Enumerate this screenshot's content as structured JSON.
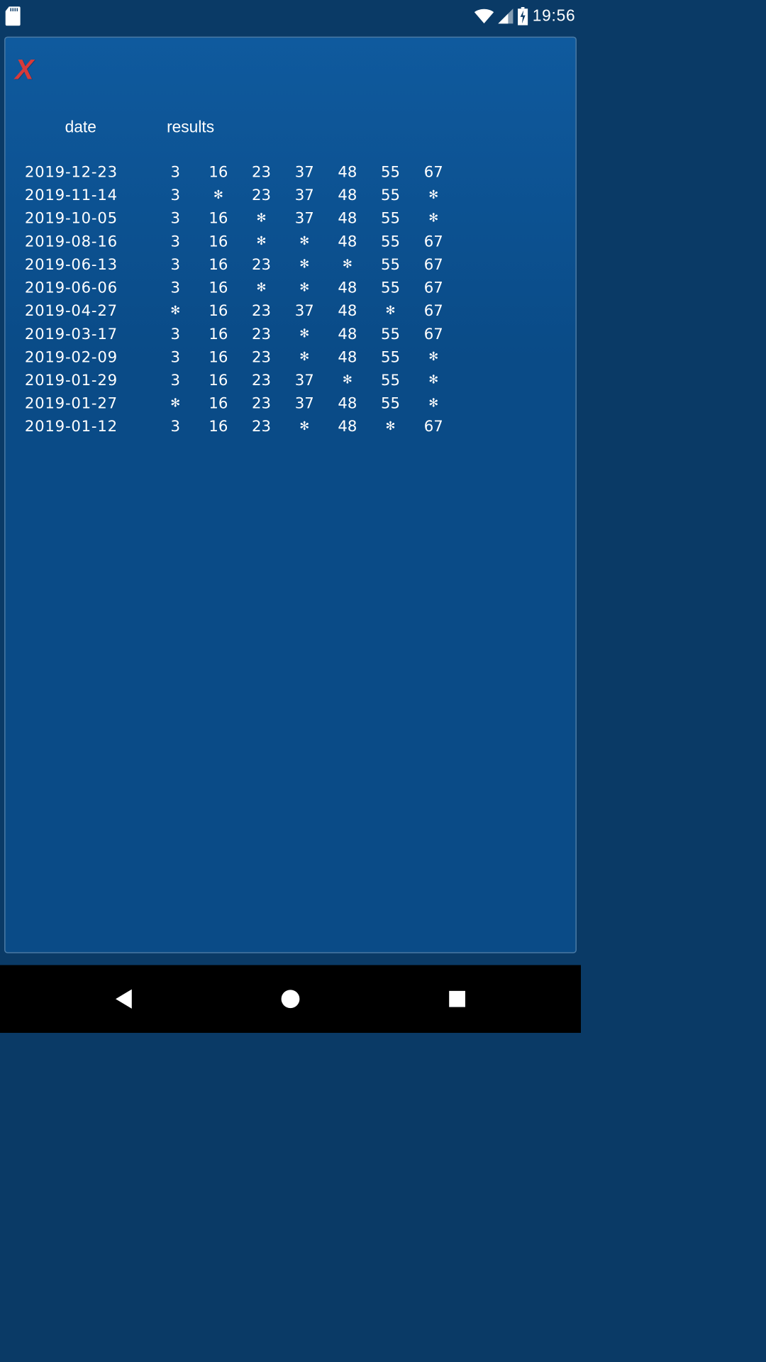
{
  "status": {
    "time": "19:56"
  },
  "panel": {
    "close_label": "X",
    "headers": {
      "date": "date",
      "results": "results"
    },
    "rows": [
      {
        "date": "2019-12-23",
        "cells": [
          "3",
          "16",
          "23",
          "37",
          "48",
          "55",
          "67"
        ]
      },
      {
        "date": "2019-11-14",
        "cells": [
          "3",
          "*",
          "23",
          "37",
          "48",
          "55",
          "*"
        ]
      },
      {
        "date": "2019-10-05",
        "cells": [
          "3",
          "16",
          "*",
          "37",
          "48",
          "55",
          "*"
        ]
      },
      {
        "date": "2019-08-16",
        "cells": [
          "3",
          "16",
          "*",
          "*",
          "48",
          "55",
          "67"
        ]
      },
      {
        "date": "2019-06-13",
        "cells": [
          "3",
          "16",
          "23",
          "*",
          "*",
          "55",
          "67"
        ]
      },
      {
        "date": "2019-06-06",
        "cells": [
          "3",
          "16",
          "*",
          "*",
          "48",
          "55",
          "67"
        ]
      },
      {
        "date": "2019-04-27",
        "cells": [
          "*",
          "16",
          "23",
          "37",
          "48",
          "*",
          "67"
        ]
      },
      {
        "date": "2019-03-17",
        "cells": [
          "3",
          "16",
          "23",
          "*",
          "48",
          "55",
          "67"
        ]
      },
      {
        "date": "2019-02-09",
        "cells": [
          "3",
          "16",
          "23",
          "*",
          "48",
          "55",
          "*"
        ]
      },
      {
        "date": "2019-01-29",
        "cells": [
          "3",
          "16",
          "23",
          "37",
          "*",
          "55",
          "*"
        ]
      },
      {
        "date": "2019-01-27",
        "cells": [
          "*",
          "16",
          "23",
          "37",
          "48",
          "55",
          "*"
        ]
      },
      {
        "date": "2019-01-12",
        "cells": [
          "3",
          "16",
          "23",
          "*",
          "48",
          "*",
          "67"
        ]
      }
    ]
  }
}
